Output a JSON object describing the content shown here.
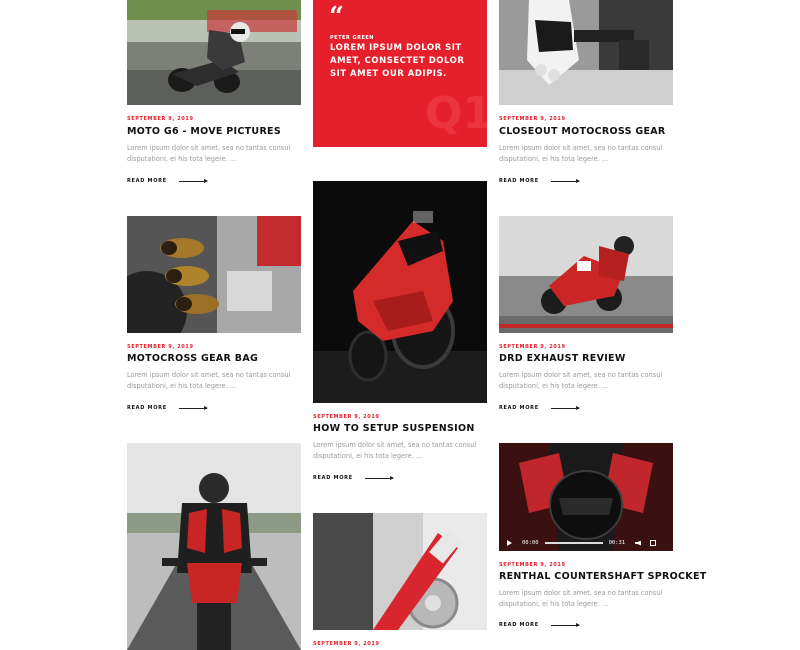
{
  "quote": {
    "author": "PETER GREEN",
    "text": "LOREM IPSUM DOLOR SIT AMET, CONSECTET DOLOR SIT AMET OUR ADIPIS.",
    "watermark": "Q1",
    "icon": "quote-mark-icon",
    "mark": "“"
  },
  "posts": [
    {
      "date": "SEPTEMBER 9, 2019",
      "title": "MOTO G6 - MOVE PICTURES",
      "excerpt": "Lorem ipsum dolor sit amet, sea no tantas consul disputationi, ei his tota legere. ...",
      "read_more": "READ MORE"
    },
    {
      "date": "SEPTEMBER 9, 2019",
      "title": "CLOSEOUT MOTOCROSS GEAR",
      "excerpt": "Lorem ipsum dolor sit amet, sea no tantas consul disputationi, ei his tota legere. ...",
      "read_more": "READ MORE"
    },
    {
      "date": "SEPTEMBER 9, 2019",
      "title": "MOTOCROSS GEAR BAG",
      "excerpt": "Lorem ipsum dolor sit amet, sea no tantas consul disputationi, ei his tota legere. ...",
      "read_more": "READ MORE"
    },
    {
      "date": "SEPTEMBER 9, 2019",
      "title": "HOW TO SETUP SUSPENSION",
      "excerpt": "Lorem ipsum dolor sit amet, sea no tantas consul disputationi, ei his tota legere. ...",
      "read_more": "READ MORE"
    },
    {
      "date": "SEPTEMBER 9, 2019",
      "title": "DRD EXHAUST REVIEW",
      "excerpt": "Lorem ipsum dolor sit amet, sea no tantas consul disputationi, ei his tota legere. ...",
      "read_more": "READ MORE"
    },
    {
      "date": "SEPTEMBER 9, 2019",
      "title": "RENTHAL COUNTERSHAFT SPROCKET",
      "excerpt": "Lorem ipsum dolor sit amet, sea no tantas consul disputationi, ei his tota legere. ...",
      "read_more": "READ MORE"
    },
    {
      "date": "SEPTEMBER 9, 2019"
    }
  ],
  "video": {
    "current_time": "00:00",
    "duration": "00:31"
  },
  "colors": {
    "accent": "#e5202c",
    "text": "#111111",
    "muted": "#9a9a9a"
  }
}
